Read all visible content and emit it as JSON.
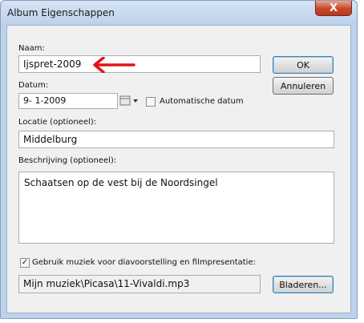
{
  "window": {
    "title": "Album Eigenschappen",
    "close_label": "X"
  },
  "form": {
    "name_label": "Naam:",
    "name_value": "Ijspret-2009",
    "date_label": "Datum:",
    "date_value": "9- 1-2009",
    "auto_date_label": "Automatische datum",
    "auto_date_checked": false,
    "location_label": "Locatie (optioneel):",
    "location_value": "Middelburg",
    "description_label": "Beschrijving (optioneel):",
    "description_value": "Schaatsen op de vest bij de Noordsingel",
    "music_label": "Gebruik muziek voor diavoorstelling en filmpresentatie:",
    "music_checked": true,
    "music_value": "Mijn muziek\\Picasa\\11-Vivaldi.mp3"
  },
  "buttons": {
    "ok": "OK",
    "cancel": "Annuleren",
    "browse": "Bladeren..."
  },
  "colors": {
    "annotation_arrow": "#e0141b"
  }
}
